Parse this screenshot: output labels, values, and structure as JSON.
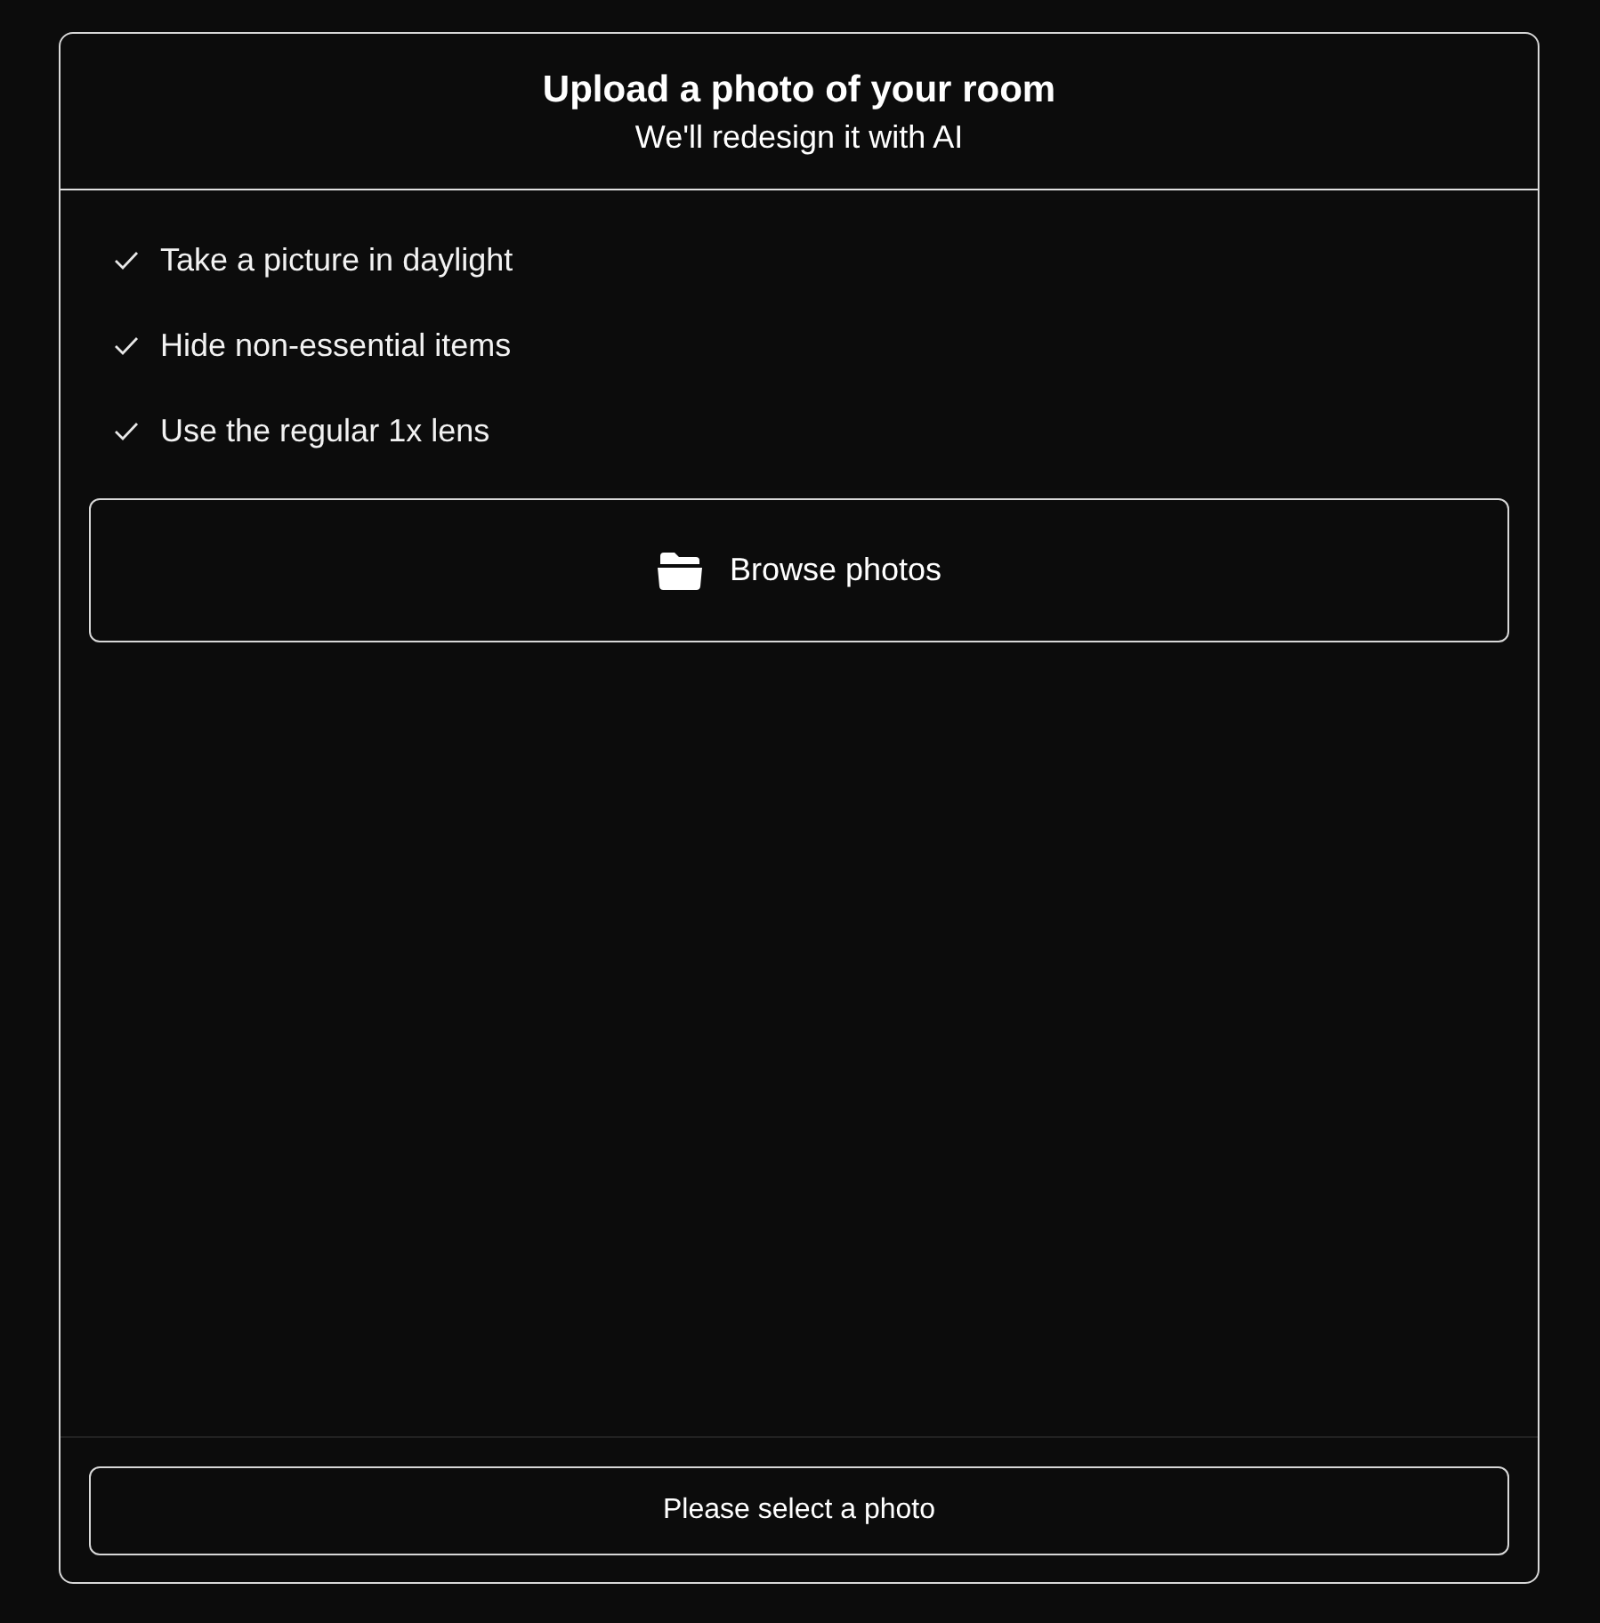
{
  "header": {
    "title": "Upload a photo of your room",
    "subtitle": "We'll redesign it with AI"
  },
  "tips": [
    "Take a picture in daylight",
    "Hide non-essential items",
    "Use the regular 1x lens"
  ],
  "browse_button": {
    "label": "Browse photos"
  },
  "submit_button": {
    "label": "Please select a photo"
  }
}
